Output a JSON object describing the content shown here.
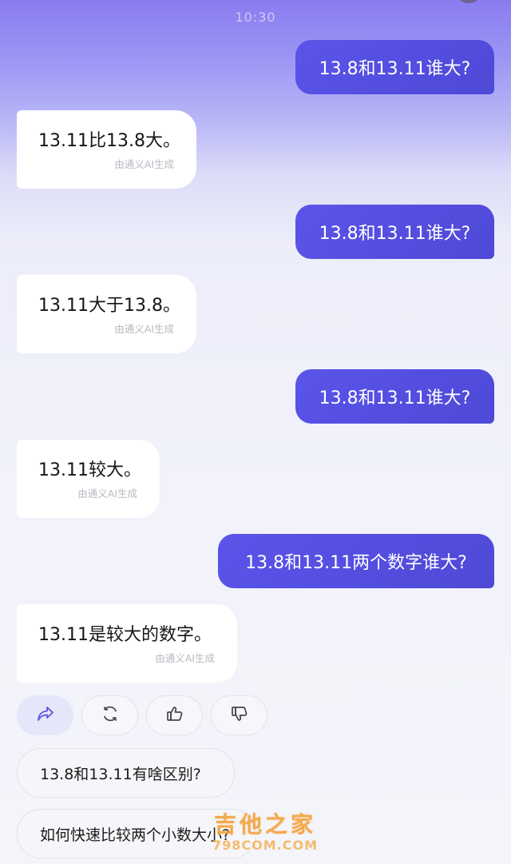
{
  "status_bar": {
    "time": "10:30"
  },
  "messages": [
    {
      "role": "user",
      "text": "13.8和13.11谁大?"
    },
    {
      "role": "ai",
      "text": "13.11比13.8大。",
      "source": "由通义AI生成"
    },
    {
      "role": "user",
      "text": "13.8和13.11谁大?"
    },
    {
      "role": "ai",
      "text": "13.11大于13.8。",
      "source": "由通义AI生成"
    },
    {
      "role": "user",
      "text": "13.8和13.11谁大?"
    },
    {
      "role": "ai",
      "text": "13.11较大。",
      "source": "由通义AI生成"
    },
    {
      "role": "user",
      "text": "13.8和13.11两个数字谁大?"
    },
    {
      "role": "ai",
      "text": "13.11是较大的数字。",
      "source": "由通义AI生成"
    }
  ],
  "actions": [
    {
      "name": "share",
      "icon": "share-icon",
      "active": true
    },
    {
      "name": "regenerate",
      "icon": "refresh-icon",
      "active": false
    },
    {
      "name": "like",
      "icon": "thumbs-up-icon",
      "active": false
    },
    {
      "name": "dislike",
      "icon": "thumbs-down-icon",
      "active": false
    }
  ],
  "suggestions": [
    "13.8和13.11有啥区别?",
    "如何快速比较两个小数大小?"
  ],
  "watermark": {
    "title": "吉他之家",
    "subtitle": "798COM.COM"
  },
  "colors": {
    "user_bubble": "#5a54ea",
    "ai_bubble": "#ffffff",
    "source_text": "#b9b9c2",
    "accent_icon": "#5b57e0"
  }
}
